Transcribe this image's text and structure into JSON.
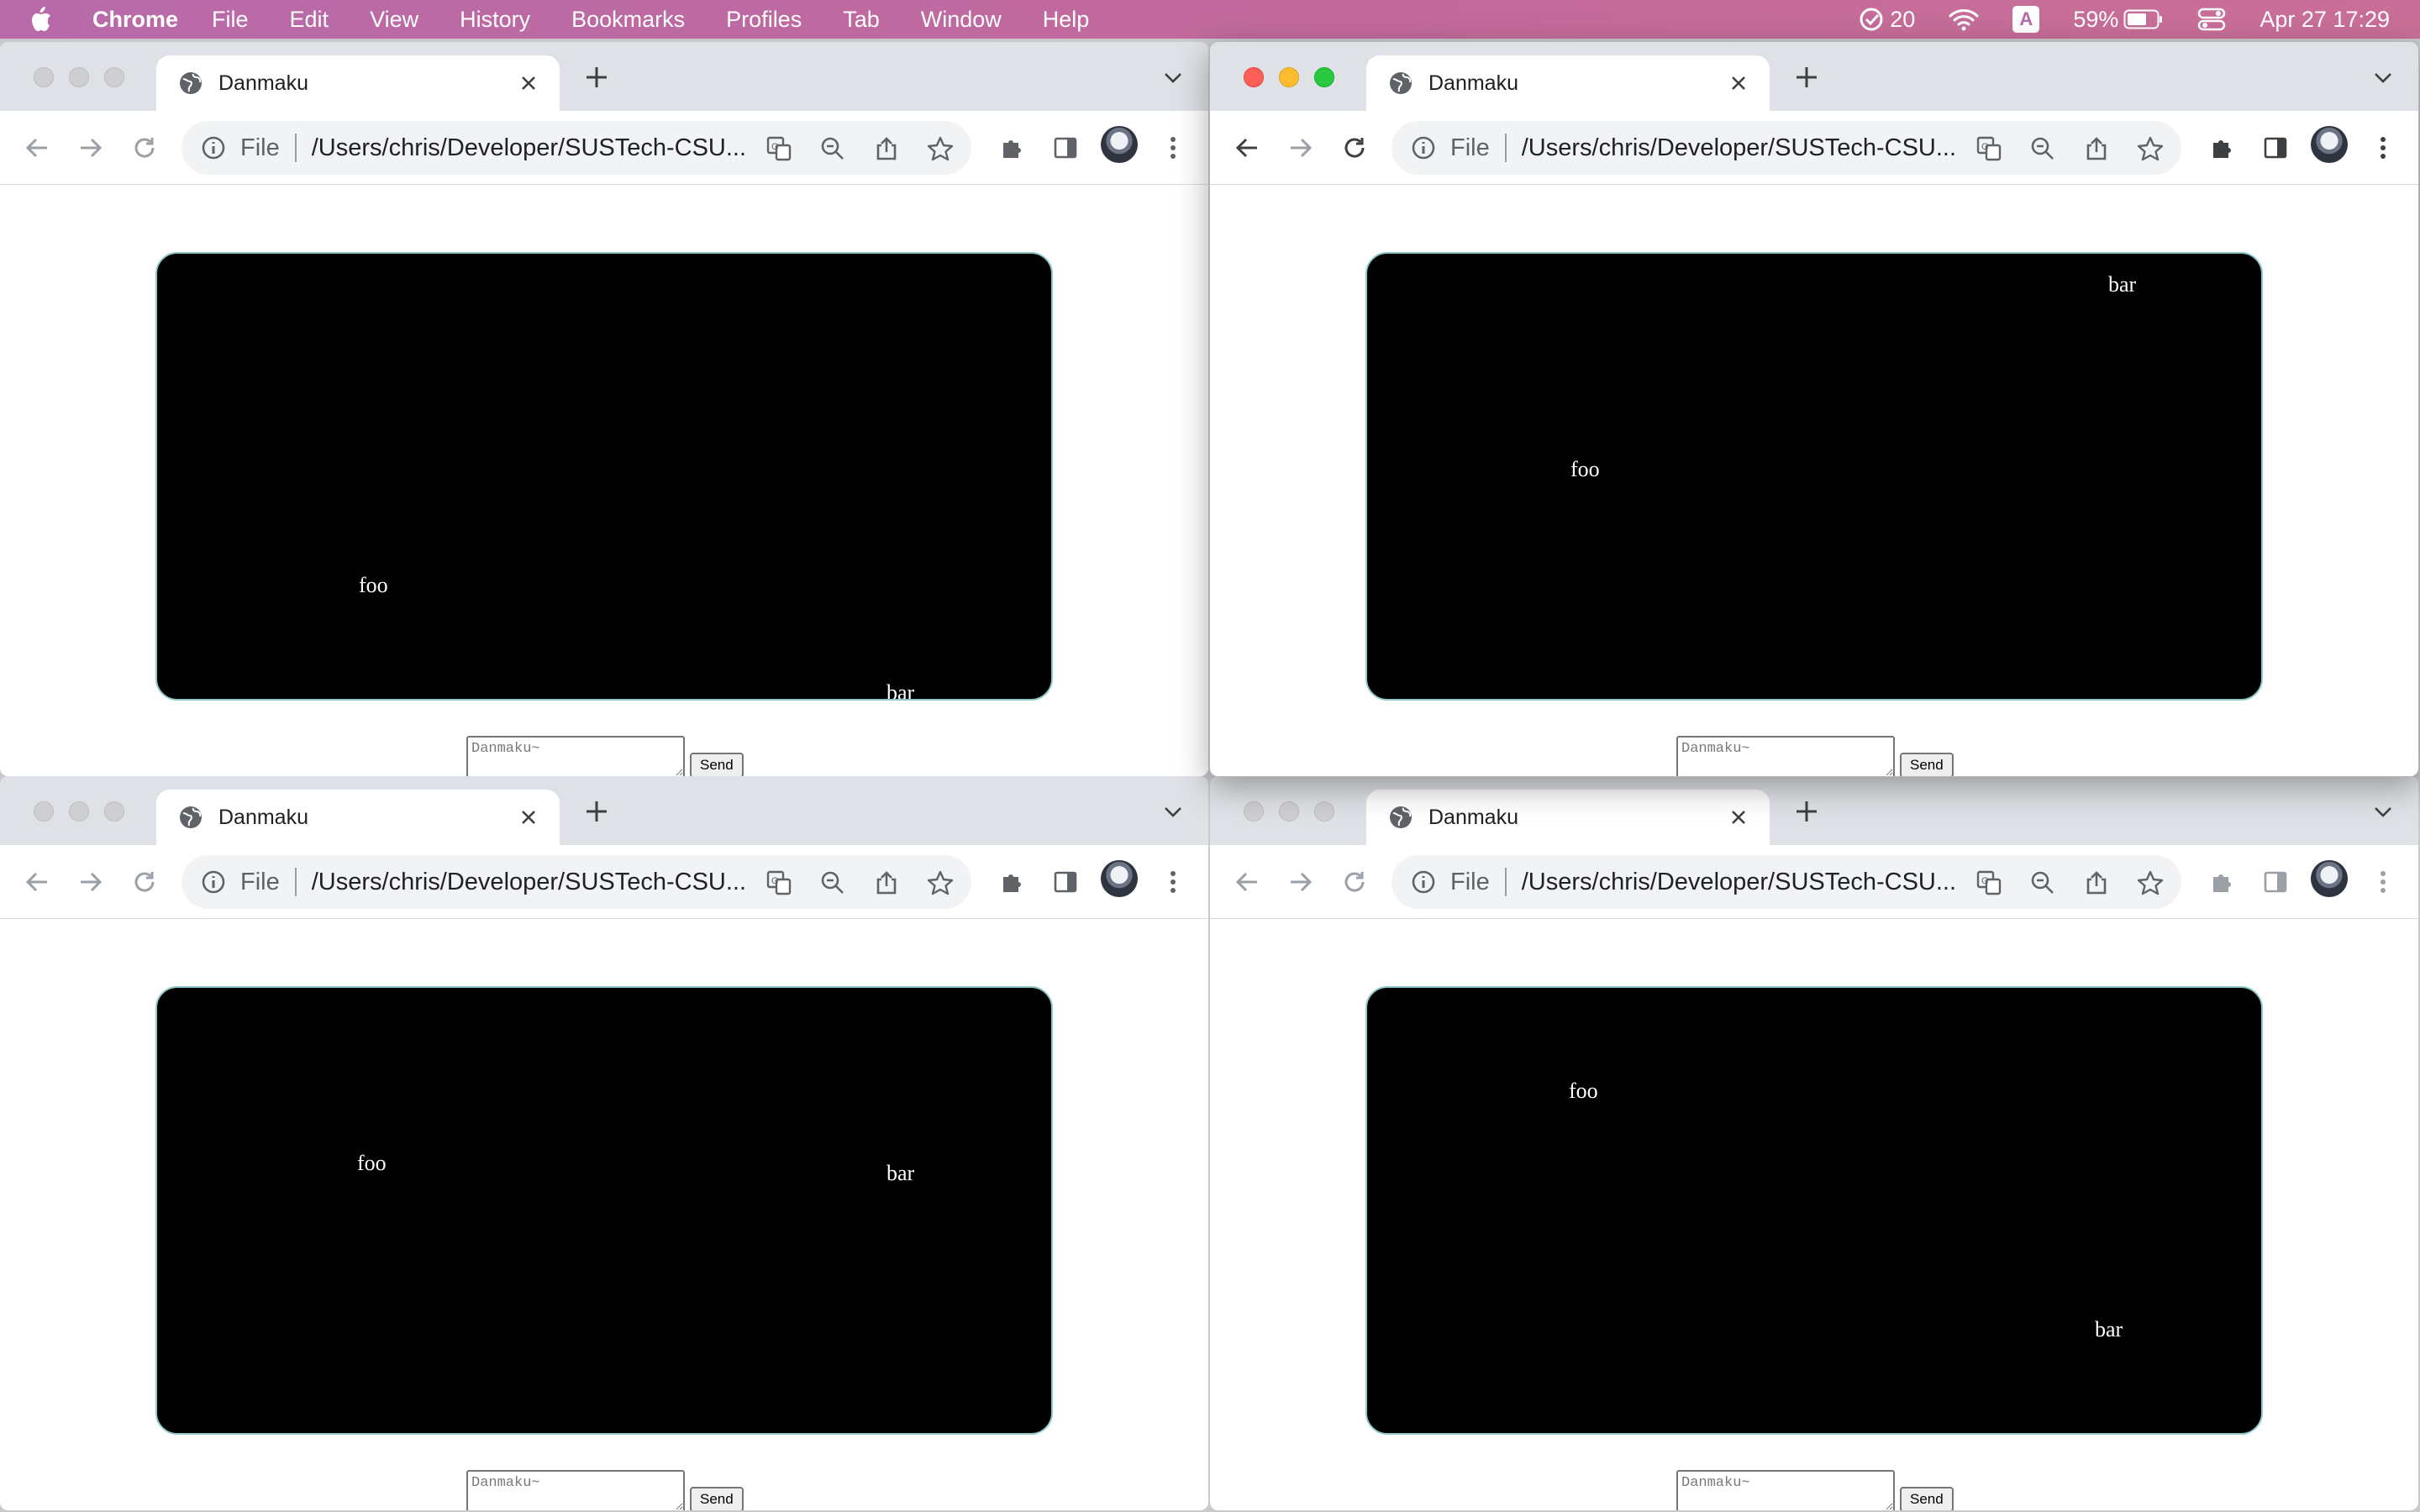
{
  "menubar": {
    "app": "Chrome",
    "menus": [
      "File",
      "Edit",
      "View",
      "History",
      "Bookmarks",
      "Profiles",
      "Tab",
      "Window",
      "Help"
    ],
    "status": {
      "tasks_count": "20",
      "input_source": "A",
      "battery": "59%",
      "datetime": "Apr 27  17:29"
    }
  },
  "browser": {
    "tab_title": "Danmaku",
    "omnibox_scheme": "File",
    "url": "/Users/chris/Developer/SUSTech-CSU...",
    "textarea_placeholder": "Danmaku~",
    "send_label": "Send"
  },
  "windows": [
    {
      "id": "top-left",
      "active": false,
      "messages": [
        {
          "text": "foo"
        },
        {
          "text": "bar"
        }
      ]
    },
    {
      "id": "top-right",
      "active": true,
      "messages": [
        {
          "text": "bar"
        },
        {
          "text": "foo"
        }
      ]
    },
    {
      "id": "bottom-left",
      "active": false,
      "messages": [
        {
          "text": "foo"
        },
        {
          "text": "bar"
        }
      ]
    },
    {
      "id": "bottom-right",
      "active": false,
      "messages": [
        {
          "text": "foo"
        },
        {
          "text": "bar"
        }
      ]
    }
  ],
  "colors": {
    "menubar_gradient": [
      "#b86aa9",
      "#c96f97"
    ],
    "stage_background": "#000000",
    "stage_border": "#8fc9c9",
    "danmaku_text": "#ffffff"
  }
}
